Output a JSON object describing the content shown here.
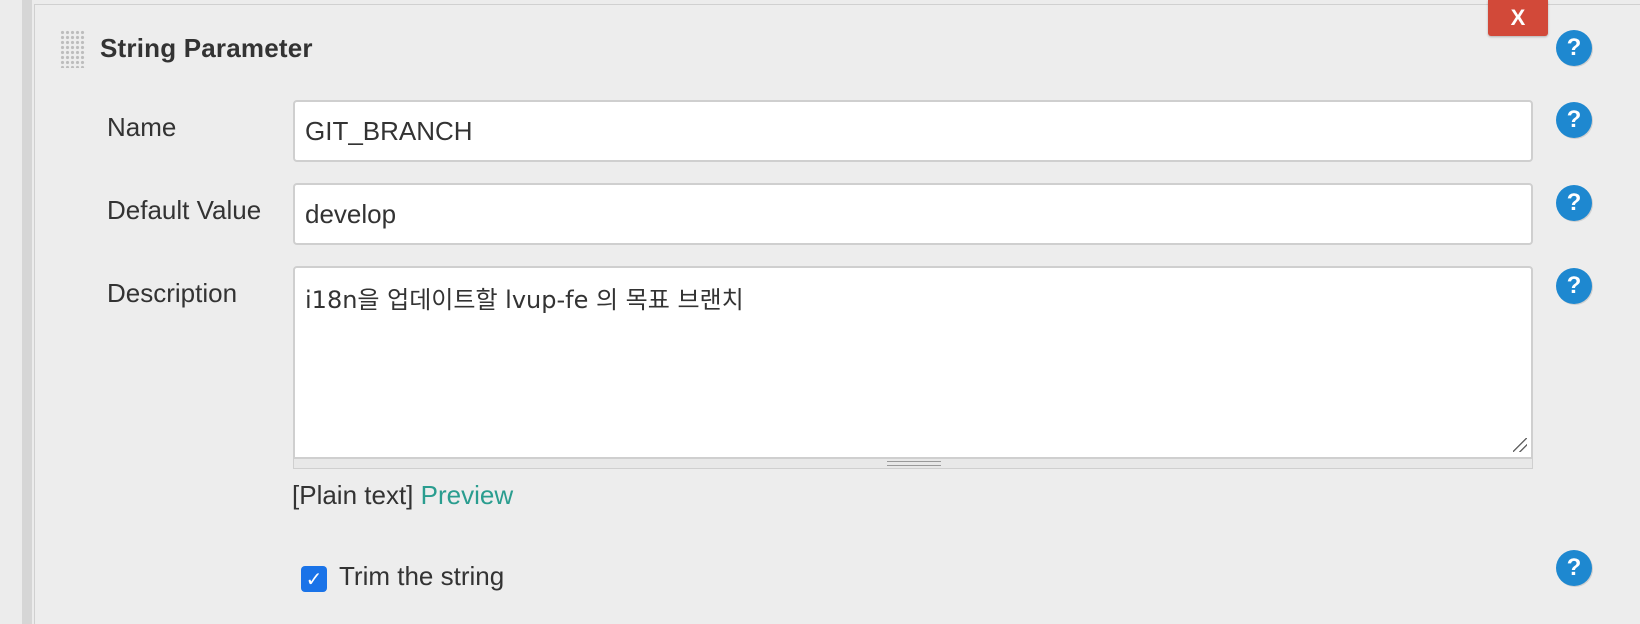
{
  "header": {
    "title": "String Parameter",
    "delete_label": "X",
    "help_label": "?"
  },
  "fields": {
    "name": {
      "label": "Name",
      "value": "GIT_BRANCH",
      "help_label": "?"
    },
    "default_value": {
      "label": "Default Value",
      "value": "develop",
      "help_label": "?"
    },
    "description": {
      "label": "Description",
      "value": "i18n을 업데이트할 lvup-fe 의 목표 브랜치",
      "help_label": "?"
    }
  },
  "markup": {
    "plain_text_label": "[Plain text]",
    "preview_label": "Preview"
  },
  "trim": {
    "label": "Trim the string",
    "checked": true,
    "check_glyph": "✓",
    "help_label": "?"
  },
  "colors": {
    "delete_button": "#d24939",
    "help_icon": "#1e88d0",
    "link": "#2a9d8f",
    "checkbox": "#1a73e8"
  },
  "icons": {
    "help": "question-mark-circle-icon",
    "delete": "close-x-icon",
    "drag": "drag-handle-icon",
    "check": "checkmark-icon"
  }
}
